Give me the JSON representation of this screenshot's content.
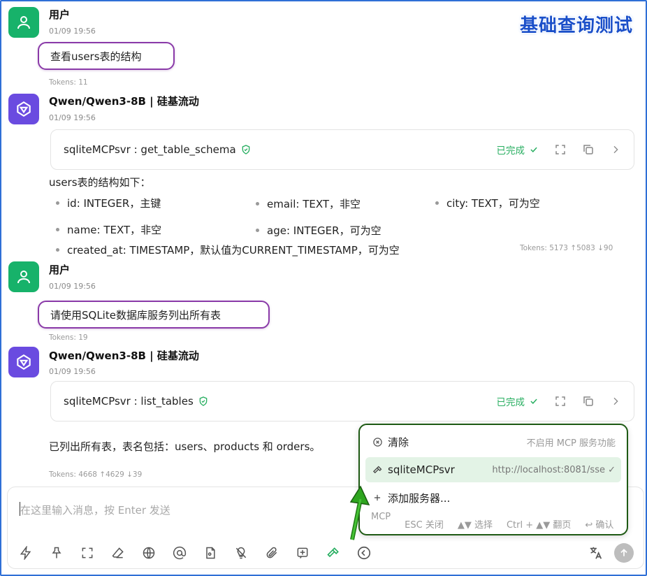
{
  "watermark": "基础查询测试",
  "messages": {
    "m1": {
      "sender": "用户",
      "time": "01/09 19:56",
      "text": "查看users表的结构",
      "tokens": "Tokens: 11"
    },
    "m2": {
      "sender": "Qwen/Qwen3-8B | 硅基流动",
      "time": "01/09 19:56",
      "tool": "sqliteMCPsvr : get_table_schema",
      "status": "已完成",
      "intro": "users表的结构如下：",
      "fields": [
        "id: INTEGER，主键",
        "email: TEXT，非空",
        "city: TEXT，可为空",
        "name: TEXT，非空",
        "age: INTEGER，可为空",
        "created_at: TIMESTAMP，默认值为CURRENT_TIMESTAMP，可为空"
      ],
      "tokens": "Tokens: 5173 ↑5083 ↓90"
    },
    "m3": {
      "sender": "用户",
      "time": "01/09 19:56",
      "text": "请使用SQLite数据库服务列出所有表",
      "tokens": "Tokens: 19"
    },
    "m4": {
      "sender": "Qwen/Qwen3-8B | 硅基流动",
      "time": "01/09 19:56",
      "tool": "sqliteMCPsvr : list_tables",
      "status": "已完成",
      "text": "已列出所有表，表名包括：users、products 和 orders。",
      "tokens": "Tokens: 4668 ↑4629 ↓39"
    }
  },
  "input": {
    "placeholder": "在这里输入消息，按 Enter 发送"
  },
  "toolbar_icons": [
    "lightning-icon",
    "pin-icon",
    "fullscreen-icon",
    "eraser-icon",
    "globe-icon",
    "at-icon",
    "document-icon",
    "lightbulb-off-icon",
    "paperclip-icon",
    "add-note-icon",
    "hammer-icon",
    "chevron-left-icon"
  ],
  "mcp_popup": {
    "clear": {
      "label": "清除",
      "hint": "不启用 MCP 服务功能"
    },
    "server": {
      "label": "sqliteMCPsvr",
      "hint": "http://localhost:8081/sse ✓"
    },
    "add": {
      "label": "添加服务器..."
    },
    "footer": [
      "MCP",
      "ESC 关闭",
      "▲▼ 选择",
      "Ctrl + ▲▼ 翻页",
      "↩ 确认"
    ]
  },
  "colors": {
    "accent_green": "#27ae60",
    "user_avatar": "#17b26a",
    "model_avatar": "#6a4be0",
    "highlight_purple": "#8a3aa8",
    "popup_border": "#1e5a14"
  }
}
